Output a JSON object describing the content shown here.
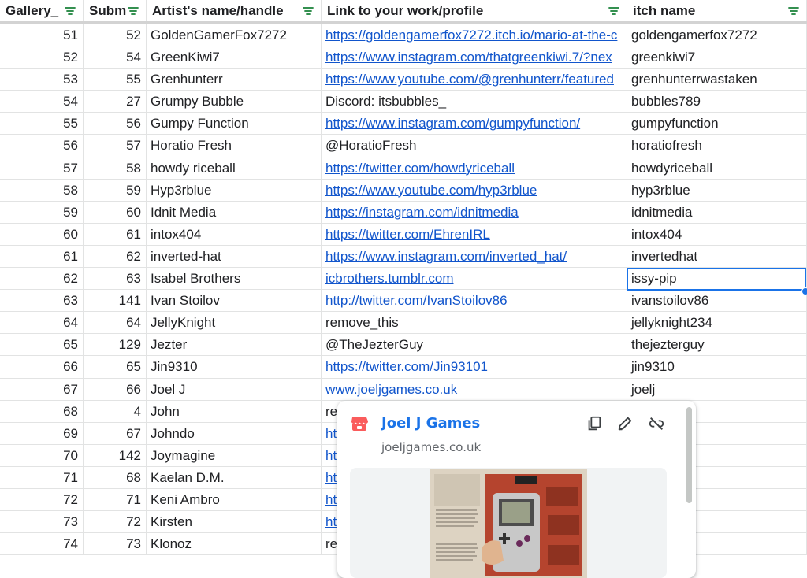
{
  "headers": [
    {
      "label": "Gallery_"
    },
    {
      "label": "Subm"
    },
    {
      "label": "Artist's name/handle"
    },
    {
      "label": "Link to your work/profile"
    },
    {
      "label": "itch name"
    }
  ],
  "rows": [
    {
      "gallery": "51",
      "sub": "52",
      "artist": "GoldenGamerFox7272",
      "link": "https://goldengamerfox7272.itch.io/mario-at-the-c",
      "link_is_url": true,
      "itch": "goldengamerfox7272"
    },
    {
      "gallery": "52",
      "sub": "54",
      "artist": "GreenKiwi7",
      "link": "https://www.instagram.com/thatgreenkiwi.7/?nex",
      "link_is_url": true,
      "itch": "greenkiwi7"
    },
    {
      "gallery": "53",
      "sub": "55",
      "artist": "Grenhunterr",
      "link": "https://www.youtube.com/@grenhunterr/featured",
      "link_is_url": true,
      "itch": "grenhunterrwastaken"
    },
    {
      "gallery": "54",
      "sub": "27",
      "artist": "Grumpy Bubble",
      "link": "Discord: itsbubbles_",
      "link_is_url": false,
      "itch": "bubbles789"
    },
    {
      "gallery": "55",
      "sub": "56",
      "artist": "Gumpy Function",
      "link": "https://www.instagram.com/gumpyfunction/",
      "link_is_url": true,
      "itch": "gumpyfunction"
    },
    {
      "gallery": "56",
      "sub": "57",
      "artist": "Horatio Fresh",
      "link": "@HoratioFresh",
      "link_is_url": false,
      "itch": "horatiofresh"
    },
    {
      "gallery": "57",
      "sub": "58",
      "artist": "howdy riceball",
      "link": "https://twitter.com/howdyriceball",
      "link_is_url": true,
      "itch": "howdyriceball"
    },
    {
      "gallery": "58",
      "sub": "59",
      "artist": "Hyp3rblue",
      "link": "https://www.youtube.com/hyp3rblue",
      "link_is_url": true,
      "itch": "hyp3rblue"
    },
    {
      "gallery": "59",
      "sub": "60",
      "artist": "Idnit Media",
      "link": "https://instagram.com/idnitmedia",
      "link_is_url": true,
      "itch": "idnitmedia"
    },
    {
      "gallery": "60",
      "sub": "61",
      "artist": "intox404",
      "link": "https://twitter.com/EhrenIRL",
      "link_is_url": true,
      "itch": "intox404"
    },
    {
      "gallery": "61",
      "sub": "62",
      "artist": "inverted-hat",
      "link": "https://www.instagram.com/inverted_hat/",
      "link_is_url": true,
      "itch": "invertedhat"
    },
    {
      "gallery": "62",
      "sub": "63",
      "artist": "Isabel Brothers",
      "link": "icbrothers.tumblr.com",
      "link_is_url": true,
      "itch": "issy-pip"
    },
    {
      "gallery": "63",
      "sub": "141",
      "artist": "Ivan Stoilov",
      "link": "http://twitter.com/IvanStoilov86",
      "link_is_url": true,
      "itch": "ivanstoilov86"
    },
    {
      "gallery": "64",
      "sub": "64",
      "artist": "JellyKnight",
      "link": "remove_this",
      "link_is_url": false,
      "itch": "jellyknight234"
    },
    {
      "gallery": "65",
      "sub": "129",
      "artist": "Jezter",
      "link": "@TheJezterGuy",
      "link_is_url": false,
      "itch": "thejezterguy"
    },
    {
      "gallery": "66",
      "sub": "65",
      "artist": "Jin9310",
      "link": "https://twitter.com/Jin93101",
      "link_is_url": true,
      "itch": "jin9310"
    },
    {
      "gallery": "67",
      "sub": "66",
      "artist": "Joel J",
      "link": "www.joeljgames.co.uk",
      "link_is_url": true,
      "itch": "joelj"
    },
    {
      "gallery": "68",
      "sub": "4",
      "artist": "John",
      "link": "re",
      "link_is_url": false,
      "itch": "nas"
    },
    {
      "gallery": "69",
      "sub": "67",
      "artist": "Johndo",
      "link": "ht",
      "link_is_url": true,
      "itch": ""
    },
    {
      "gallery": "70",
      "sub": "142",
      "artist": "Joymagine",
      "link": "ht",
      "link_is_url": true,
      "itch": ""
    },
    {
      "gallery": "71",
      "sub": "68",
      "artist": "Kaelan D.M.",
      "link": "ht",
      "link_is_url": true,
      "itch": ""
    },
    {
      "gallery": "72",
      "sub": "71",
      "artist": "Keni Ambro",
      "link": "ht",
      "link_is_url": true,
      "itch": "o"
    },
    {
      "gallery": "73",
      "sub": "72",
      "artist": "Kirsten",
      "link": "ht",
      "link_is_url": true,
      "itch": "zabeth"
    },
    {
      "gallery": "74",
      "sub": "73",
      "artist": "Klonoz",
      "link": "re",
      "link_is_url": false,
      "itch": ""
    }
  ],
  "popup": {
    "title": "Joel J Games",
    "domain": "joeljgames.co.uk",
    "icons": {
      "favicon": "itch-favicon-icon",
      "copy": "copy-icon",
      "edit": "pencil-icon",
      "unlink": "unlink-icon"
    }
  },
  "colors": {
    "link": "#1155cc",
    "selection": "#1a73e8",
    "popup_title": "#1a73e8",
    "favicon": "#fa5c5c"
  }
}
